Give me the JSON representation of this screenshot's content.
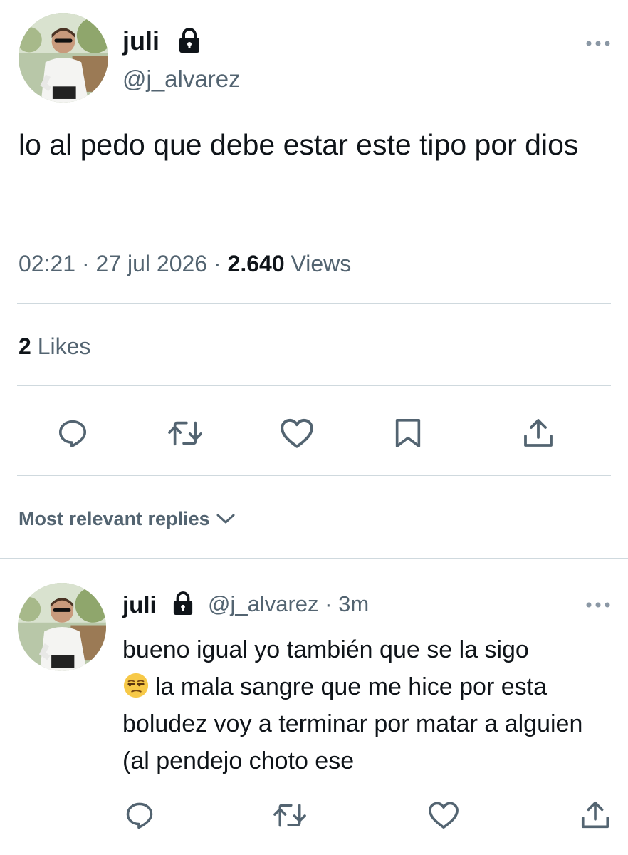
{
  "tweet": {
    "author_name": "juli",
    "author_handle": "@j_alvarez",
    "text": "lo al pedo que debe estar este tipo por dios",
    "time": "02:21",
    "date": "27 jul 2026",
    "views_count": "2.640",
    "views_label": "Views",
    "likes_count": "2",
    "likes_label": "Likes",
    "separator": " · "
  },
  "replies_sort": {
    "label": "Most relevant replies"
  },
  "reply": {
    "author_name": "juli",
    "author_handle": "@j_alvarez",
    "time_ago": "3m",
    "separator": " · ",
    "text_line1": "bueno igual yo también que se la sigo",
    "text_rest": "la mala sangre que me hice por esta boludez voy a terminar por matar a alguien (al pendejo choto ese",
    "emoji": "unamused-face-emoji"
  },
  "icons": {
    "lock": "lock-icon",
    "more": "more-horizontal-icon",
    "reply": "reply-icon",
    "retweet": "retweet-icon",
    "like": "heart-icon",
    "bookmark": "bookmark-icon",
    "share": "share-icon",
    "chevron": "chevron-down-icon"
  },
  "colors": {
    "text_primary": "#0f1419",
    "text_secondary": "#536471",
    "divider": "#cfd9de"
  }
}
